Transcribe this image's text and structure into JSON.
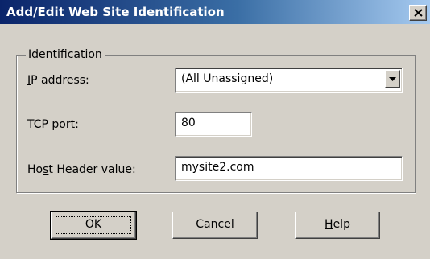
{
  "window": {
    "title": "Add/Edit Web Site Identification"
  },
  "group": {
    "label": "Identification"
  },
  "fields": {
    "ip": {
      "label_pre": "",
      "label_accel": "I",
      "label_post": "P address:",
      "value": "(All Unassigned)"
    },
    "tcp": {
      "label_pre": "TCP p",
      "label_accel": "o",
      "label_post": "rt:",
      "value": "80"
    },
    "host": {
      "label_pre": "Ho",
      "label_accel": "s",
      "label_post": "t Header value:",
      "value": "mysite2.com"
    }
  },
  "buttons": {
    "ok": "OK",
    "cancel": "Cancel",
    "help_accel": "H",
    "help_rest": "elp"
  },
  "icons": {
    "close": "close-icon",
    "dropdown": "chevron-down-icon"
  }
}
